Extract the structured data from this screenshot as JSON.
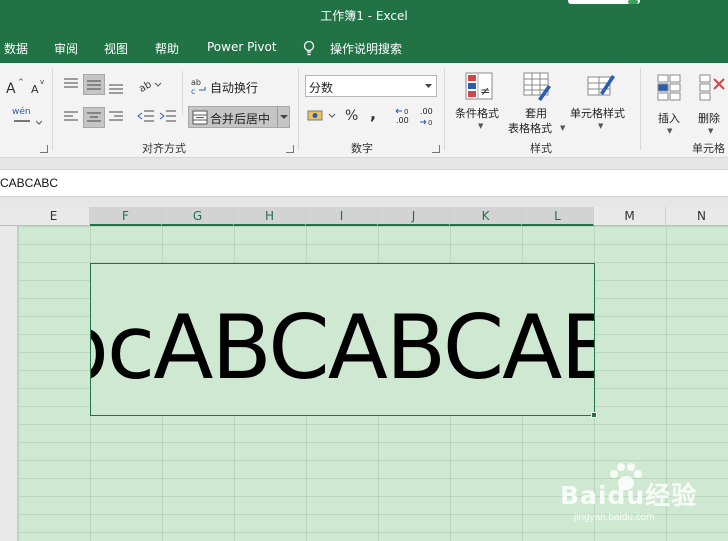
{
  "window": {
    "title": "工作簿1  -  Excel"
  },
  "menu": [
    "数据",
    "审阅",
    "视图",
    "帮助",
    "Power Pivot",
    "操作说明搜索"
  ],
  "ribbon": {
    "alignment": {
      "wrap_text": "自动换行",
      "merge_center": "合并后居中",
      "group_label": "对齐方式"
    },
    "number": {
      "format_value": "分数",
      "percent": "%",
      "comma": ",",
      "inc_decimal": ".00",
      "dec_decimal": ".00",
      "group_label": "数字"
    },
    "styles": {
      "conditional_format": "条件格式",
      "table_format_line1": "套用",
      "table_format_line2": "表格格式",
      "cell_styles": "单元格样式",
      "group_label": "样式"
    },
    "cells": {
      "insert": "插入",
      "delete": "删除",
      "group_label": "单元格"
    },
    "font": {
      "phonetic": "wén"
    }
  },
  "formula_bar": {
    "value": "CABCABC"
  },
  "columns": [
    "E",
    "F",
    "G",
    "H",
    "I",
    "J",
    "K",
    "L",
    "M",
    "N"
  ],
  "cell": {
    "text": "bcABCABCAB"
  },
  "watermark": {
    "logo": "Baidu经验",
    "url": "jingyan.baidu.com"
  },
  "colors": {
    "excel_green": "#217346",
    "sheet_bg": "#cfe8d2"
  }
}
